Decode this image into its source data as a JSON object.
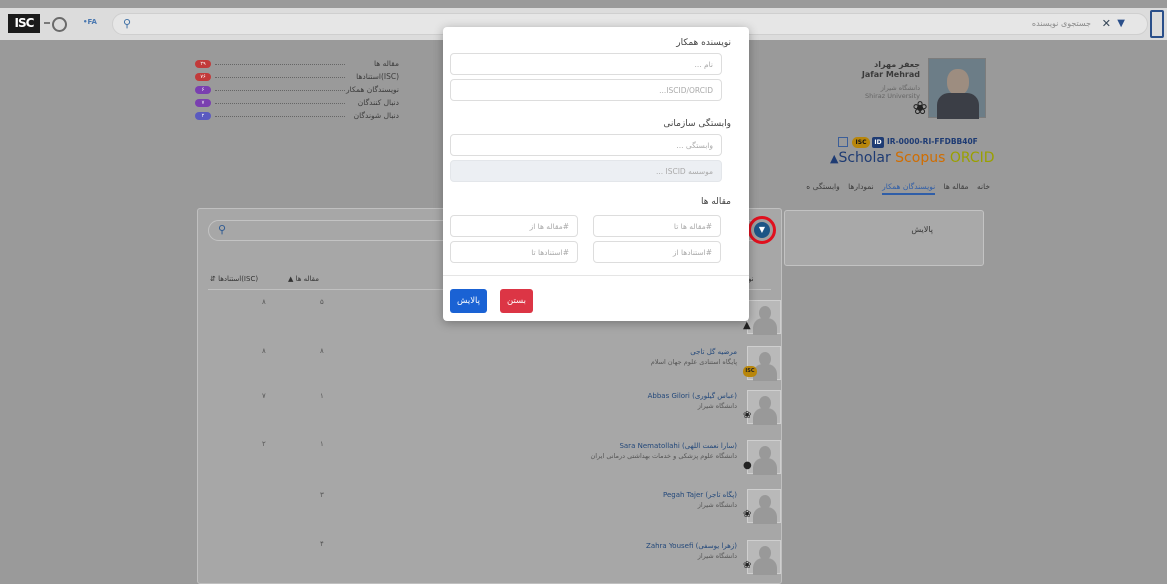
{
  "topbar": {
    "logo_text": "ISC",
    "lang": "•FA",
    "search_placeholder": "جستجوی نویسنده",
    "clear_symbol": "✕",
    "filter_symbol": "▼"
  },
  "stats": [
    {
      "label": "مقاله ها",
      "count": "۲۹",
      "color": "#c23a3a"
    },
    {
      "label": "استنادها(ISC)",
      "count": "۷۶",
      "color": "#c23a3a"
    },
    {
      "label": "نویسندگان همکار",
      "count": "۶",
      "color": "#7a3fb0"
    },
    {
      "label": "دنبال کنندگان",
      "count": "۷",
      "color": "#7a3fb0"
    },
    {
      "label": "دنبال شوندگان",
      "count": "۲",
      "color": "#5a5ac0"
    }
  ],
  "profile": {
    "name_fa": "جعفر مهراد",
    "name_en": "Jafar Mehrad",
    "university_fa": "دانشگاه شیراز",
    "university_en": "Shiraz University",
    "isc_badge": "ISC",
    "id_badge": "ID",
    "isc_id": "IR-0000-RI-FFDBB40F",
    "brand_scholar": "Scholar",
    "brand_scopus": "Scopus",
    "brand_orcid": "ORCID"
  },
  "tabs": [
    "خانه",
    "مقاله ها",
    "نویسندگان همکار",
    "نمودارها",
    "وابستگی ه"
  ],
  "filter_panel": {
    "title": "پالایش"
  },
  "table": {
    "col_articles": "مقاله ها",
    "col_citations": "استنادها(ISC)",
    "col_name_partial": "نو",
    "rows": [
      {
        "name": "",
        "aff": "",
        "articles": "۵",
        "citations": "۸",
        "badge": "cap"
      },
      {
        "name": "مرضیه گل تاجی",
        "aff": "پایگاه استنادی علوم جهان اسلام",
        "articles": "۸",
        "citations": "۸",
        "badge": "isc"
      },
      {
        "name": "Abbas Gilori (عباس گیلوری)",
        "aff": "دانشگاه شیراز",
        "articles": "۱",
        "citations": "۷",
        "badge": "logo"
      },
      {
        "name": "Sara Nematollahi (سارا نعمت اللهی)",
        "aff": "دانشگاه علوم پزشکی و خدمات بهداشتی درمانی ایران",
        "articles": "۱",
        "citations": "۲",
        "badge": "circle"
      },
      {
        "name": "Pegah Tajer (پگاه تاجر)",
        "aff": "دانشگاه شیراز",
        "articles": "۳",
        "citations": "",
        "badge": "logo"
      },
      {
        "name": "Zahra Yousefi (زهرا یوسفی)",
        "aff": "دانشگاه شیراز",
        "articles": "۴",
        "citations": "",
        "badge": "logo"
      }
    ]
  },
  "modal": {
    "coauthor_title": "نویسنده همکار",
    "name_placeholder": "نام ...",
    "iscid_placeholder": "ISCID/ORCID...",
    "affiliation_title": "وابستگی سازمانی",
    "affiliation_placeholder": "وابستگی ...",
    "institute_placeholder": "موسسه ISCID ...",
    "articles_title": "مقاله ها",
    "articles_to_placeholder": "#مقاله ها تا",
    "articles_from_placeholder": "#مقاله ها از",
    "citations_from_placeholder": "#استنادها از",
    "citations_to_placeholder": "#استنادها تا",
    "apply_label": "پالایش",
    "close_label": "بستن"
  }
}
